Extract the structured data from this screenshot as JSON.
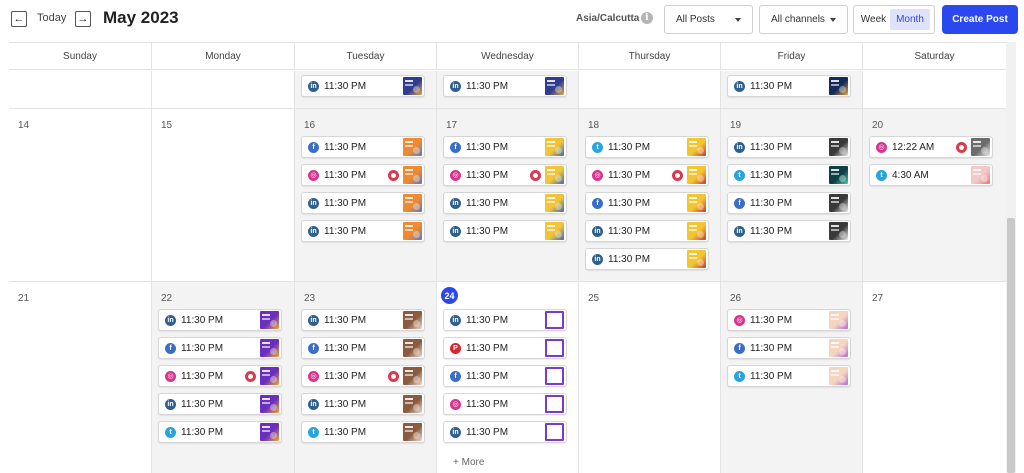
{
  "header": {
    "prev_label": "←",
    "next_label": "→",
    "today_label": "Today",
    "month_title": "May 2023",
    "timezone": "Asia/Calcutta",
    "info_label": "i",
    "posts_filter": "All Posts",
    "channels_filter": "All channels",
    "view_week": "Week",
    "view_month": "Month",
    "active_view": "Month",
    "create_post": "Create Post"
  },
  "weekdays": [
    "Sunday",
    "Monday",
    "Tuesday",
    "Wednesday",
    "Thursday",
    "Friday",
    "Saturday"
  ],
  "colors": {
    "facebook": "#3b6ec6",
    "instagram": "#d8348f",
    "twitter": "#2aa3e0",
    "linkedin": "#2f5f8e",
    "pinterest": "#d62833",
    "alert": "#d93a4f",
    "accent": "#2b47ee"
  },
  "weeks": [
    {
      "days": [
        {
          "num": "",
          "posts": []
        },
        {
          "num": "",
          "posts": []
        },
        {
          "num": "",
          "posts": [
            {
              "net": "linkedin",
              "time": "11:30 PM",
              "thumb": "blue-flyer"
            }
          ]
        },
        {
          "num": "",
          "posts": [
            {
              "net": "linkedin",
              "time": "11:30 PM",
              "thumb": "blue-flyer"
            }
          ]
        },
        {
          "num": "",
          "posts": []
        },
        {
          "num": "",
          "posts": [
            {
              "net": "linkedin",
              "time": "11:30 PM",
              "thumb": "navy-flyer"
            }
          ]
        },
        {
          "num": "",
          "posts": []
        }
      ]
    },
    {
      "days": [
        {
          "num": "14",
          "posts": []
        },
        {
          "num": "15",
          "posts": []
        },
        {
          "num": "16",
          "posts": [
            {
              "net": "facebook",
              "time": "11:30 PM",
              "thumb": "orange-flyer"
            },
            {
              "net": "instagram",
              "time": "11:30 PM",
              "thumb": "orange-flyer",
              "alert": true
            },
            {
              "net": "linkedin",
              "time": "11:30 PM",
              "thumb": "orange-flyer"
            },
            {
              "net": "linkedin",
              "time": "11:30 PM",
              "thumb": "orange-flyer"
            }
          ]
        },
        {
          "num": "17",
          "posts": [
            {
              "net": "facebook",
              "time": "11:30 PM",
              "thumb": "yellow-flyer"
            },
            {
              "net": "instagram",
              "time": "11:30 PM",
              "thumb": "yellow-flyer",
              "alert": true
            },
            {
              "net": "linkedin",
              "time": "11:30 PM",
              "thumb": "yellow-flyer"
            },
            {
              "net": "linkedin",
              "time": "11:30 PM",
              "thumb": "yellow-flyer"
            }
          ]
        },
        {
          "num": "18",
          "posts": [
            {
              "net": "twitter",
              "time": "11:30 PM",
              "thumb": "gold-flyer"
            },
            {
              "net": "instagram",
              "time": "11:30 PM",
              "thumb": "gold-flyer",
              "alert": true
            },
            {
              "net": "facebook",
              "time": "11:30 PM",
              "thumb": "gold-flyer"
            },
            {
              "net": "linkedin",
              "time": "11:30 PM",
              "thumb": "gold-flyer"
            },
            {
              "net": "linkedin",
              "time": "11:30 PM",
              "thumb": "gold-flyer"
            }
          ]
        },
        {
          "num": "19",
          "posts": [
            {
              "net": "linkedin",
              "time": "11:30 PM",
              "thumb": "dark-flyer"
            },
            {
              "net": "twitter",
              "time": "11:30 PM",
              "thumb": "teal-flyer"
            },
            {
              "net": "facebook",
              "time": "11:30 PM",
              "thumb": "dark-flyer"
            },
            {
              "net": "linkedin",
              "time": "11:30 PM",
              "thumb": "dark-flyer"
            }
          ]
        },
        {
          "num": "20",
          "posts": [
            {
              "net": "instagram",
              "time": "12:22 AM",
              "thumb": "grey-flyer",
              "alert": true
            },
            {
              "net": "twitter",
              "time": "4:30 AM",
              "thumb": "pink-flyer"
            }
          ]
        }
      ]
    },
    {
      "days": [
        {
          "num": "21",
          "posts": []
        },
        {
          "num": "22",
          "posts": [
            {
              "net": "linkedin",
              "time": "11:30 PM",
              "thumb": "purple-flyer"
            },
            {
              "net": "facebook",
              "time": "11:30 PM",
              "thumb": "purple-flyer"
            },
            {
              "net": "instagram",
              "time": "11:30 PM",
              "thumb": "purple-flyer",
              "alert": true
            },
            {
              "net": "linkedin",
              "time": "11:30 PM",
              "thumb": "purple-flyer"
            },
            {
              "net": "twitter",
              "time": "11:30 PM",
              "thumb": "purple-flyer"
            }
          ]
        },
        {
          "num": "23",
          "posts": [
            {
              "net": "linkedin",
              "time": "11:30 PM",
              "thumb": "brown-flyer"
            },
            {
              "net": "facebook",
              "time": "11:30 PM",
              "thumb": "brown-flyer"
            },
            {
              "net": "instagram",
              "time": "11:30 PM",
              "thumb": "brown-flyer",
              "alert": true
            },
            {
              "net": "linkedin",
              "time": "11:30 PM",
              "thumb": "brown-flyer"
            },
            {
              "net": "twitter",
              "time": "11:30 PM",
              "thumb": "brown-flyer"
            }
          ]
        },
        {
          "num": "24",
          "today": true,
          "more": "+ More",
          "posts": [
            {
              "net": "linkedin",
              "time": "11:30 PM",
              "thumb": "violet-frame"
            },
            {
              "net": "pinterest",
              "time": "11:30 PM",
              "thumb": "violet-frame"
            },
            {
              "net": "facebook",
              "time": "11:30 PM",
              "thumb": "violet-frame"
            },
            {
              "net": "instagram",
              "time": "11:30 PM",
              "thumb": "violet-frame"
            },
            {
              "net": "linkedin",
              "time": "11:30 PM",
              "thumb": "violet-frame"
            }
          ]
        },
        {
          "num": "25",
          "posts": []
        },
        {
          "num": "26",
          "posts": [
            {
              "net": "instagram",
              "time": "11:30 PM",
              "thumb": "peach-flyer"
            },
            {
              "net": "facebook",
              "time": "11:30 PM",
              "thumb": "peach-flyer"
            },
            {
              "net": "twitter",
              "time": "11:30 PM",
              "thumb": "peach-flyer"
            }
          ]
        },
        {
          "num": "27",
          "posts": []
        }
      ]
    }
  ],
  "thumb_colors": {
    "blue-flyer": [
      "#2f3c8f",
      "#e8a53b"
    ],
    "navy-flyer": [
      "#142b5a",
      "#f0a23a"
    ],
    "orange-flyer": [
      "#f08a32",
      "#5a7bbf"
    ],
    "yellow-flyer": [
      "#f2c438",
      "#3c66b0"
    ],
    "gold-flyer": [
      "#f3c531",
      "#c9392b"
    ],
    "dark-flyer": [
      "#3a3a3a",
      "#f0f0f0"
    ],
    "teal-flyer": [
      "#0e3f45",
      "#48c9a8"
    ],
    "grey-flyer": [
      "#6b6b6b",
      "#ededed"
    ],
    "pink-flyer": [
      "#f3c8c8",
      "#e07a7a"
    ],
    "purple-flyer": [
      "#6a2fc0",
      "#f1a52c"
    ],
    "brown-flyer": [
      "#8a5b3f",
      "#f0dccf"
    ],
    "violet-frame": [
      "#7a3bc8",
      "#ffffff"
    ],
    "peach-flyer": [
      "#f6d5c0",
      "#b36ad0"
    ]
  }
}
